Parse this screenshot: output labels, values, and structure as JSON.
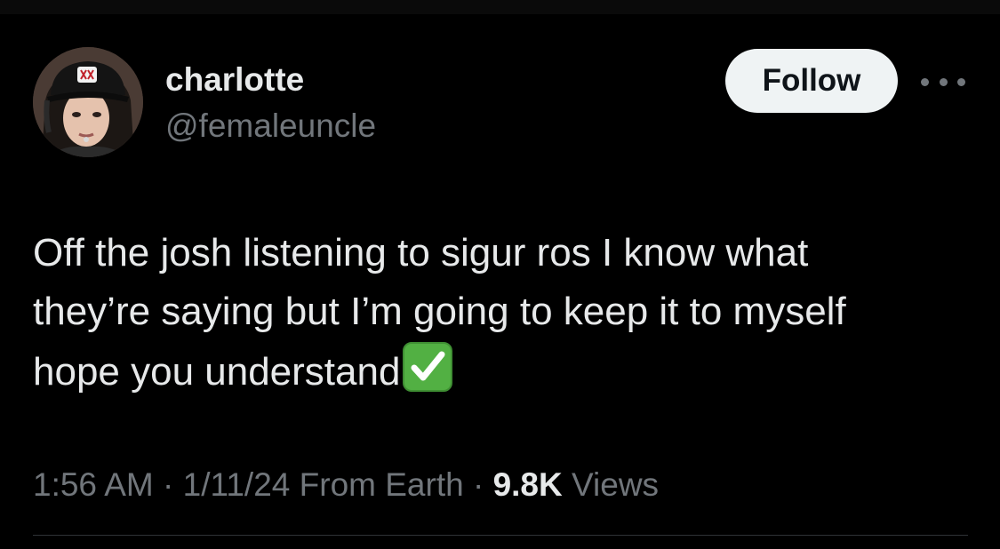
{
  "user": {
    "display_name": "charlotte",
    "handle": "@femaleuncle"
  },
  "actions": {
    "follow_label": "Follow"
  },
  "tweet": {
    "lines": [
      "Off the josh listening to sigur ros I know what",
      "they’re saying but I’m going to keep it to myself",
      "hope you understand"
    ],
    "trailing_emoji": "check-mark-button-emoji"
  },
  "meta": {
    "time": "1:56 AM",
    "date": "1/11/24",
    "source": "From Earth",
    "separator": "·",
    "views_count": "9.8K",
    "views_label": "Views"
  },
  "colors": {
    "background": "#000000",
    "primary_text": "#e7e9ea",
    "secondary_text": "#71767b",
    "follow_bg": "#eff3f4",
    "follow_text": "#0f1419",
    "divider": "#2f3336",
    "emoji_green": "#52b043"
  }
}
